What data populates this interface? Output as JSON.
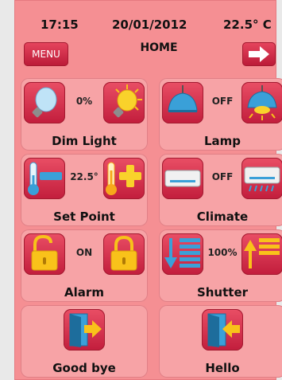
{
  "status": {
    "time": "17:15",
    "date": "20/01/2012",
    "temperature": "22.5° C"
  },
  "header": {
    "menu_label": "MENU",
    "title": "HOME",
    "next_icon": "arrow-right-icon"
  },
  "tiles": [
    {
      "label": "Dim Light",
      "value": "0%",
      "left_icon": "bulb-off-icon",
      "right_icon": "bulb-on-icon"
    },
    {
      "label": "Lamp",
      "value": "OFF",
      "left_icon": "lamp-off-icon",
      "right_icon": "lamp-on-icon"
    },
    {
      "label": "Set Point",
      "value": "22.5°",
      "left_icon": "thermometer-minus-icon",
      "right_icon": "thermometer-plus-icon"
    },
    {
      "label": "Climate",
      "value": "OFF",
      "left_icon": "ac-off-icon",
      "right_icon": "ac-on-icon"
    },
    {
      "label": "Alarm",
      "value": "ON",
      "left_icon": "padlock-open-icon",
      "right_icon": "padlock-closed-icon"
    },
    {
      "label": "Shutter",
      "value": "100%",
      "left_icon": "shutter-down-icon",
      "right_icon": "shutter-up-icon"
    },
    {
      "label": "Good bye",
      "value": "",
      "icon": "door-exit-icon"
    },
    {
      "label": "Hello",
      "value": "",
      "icon": "door-enter-icon"
    }
  ],
  "colors": {
    "panel": "#f58f93",
    "button": "#d12a47",
    "accent_yellow": "#f7c21a",
    "icon_blue": "#3aa0d8"
  }
}
